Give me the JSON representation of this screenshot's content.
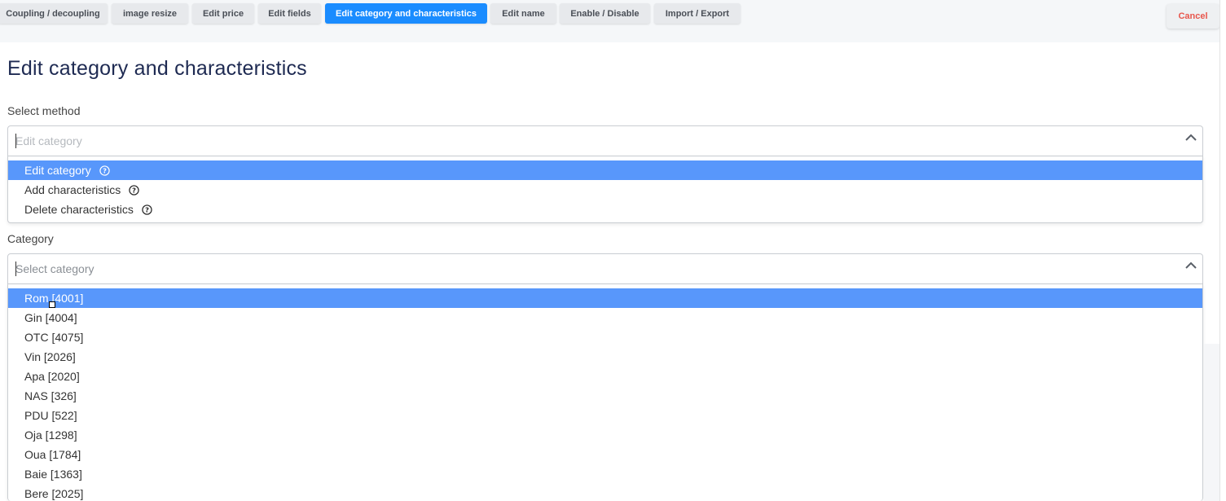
{
  "tabs": [
    {
      "label": "Coupling / decoupling",
      "active": false
    },
    {
      "label": "image resize",
      "active": false
    },
    {
      "label": "Edit price",
      "active": false
    },
    {
      "label": "Edit fields",
      "active": false
    },
    {
      "label": "Edit category and characteristics",
      "active": true
    },
    {
      "label": "Edit name",
      "active": false
    },
    {
      "label": "Enable / Disable",
      "active": false
    },
    {
      "label": "Import / Export",
      "active": false
    }
  ],
  "cancel_label": "Cancel",
  "page_title": "Edit category and characteristics",
  "method": {
    "label": "Select method",
    "placeholder": "Edit category",
    "options": [
      {
        "label": "Edit category",
        "icon": "help-circle-icon",
        "selected": true
      },
      {
        "label": "Add characteristics",
        "icon": "help-circle-icon",
        "selected": false
      },
      {
        "label": "Delete characteristics",
        "icon": "help-circle-icon",
        "selected": false
      }
    ]
  },
  "category": {
    "label": "Category",
    "placeholder": "Select category",
    "options": [
      {
        "label": "Rom [4001]",
        "selected": true
      },
      {
        "label": "Gin [4004]",
        "selected": false
      },
      {
        "label": "OTC [4075]",
        "selected": false
      },
      {
        "label": "Vin [2026]",
        "selected": false
      },
      {
        "label": "Apa [2020]",
        "selected": false
      },
      {
        "label": "NAS [326]",
        "selected": false
      },
      {
        "label": "PDU [522]",
        "selected": false
      },
      {
        "label": "Oja [1298]",
        "selected": false
      },
      {
        "label": "Oua [1784]",
        "selected": false
      },
      {
        "label": "Baie [1363]",
        "selected": false
      },
      {
        "label": "Bere [2025]",
        "selected": false
      }
    ]
  },
  "colors": {
    "active_tab": "#1a8cff",
    "selected_option": "#5897fb",
    "cancel_text": "#e8564c",
    "title": "#1e2a52"
  }
}
